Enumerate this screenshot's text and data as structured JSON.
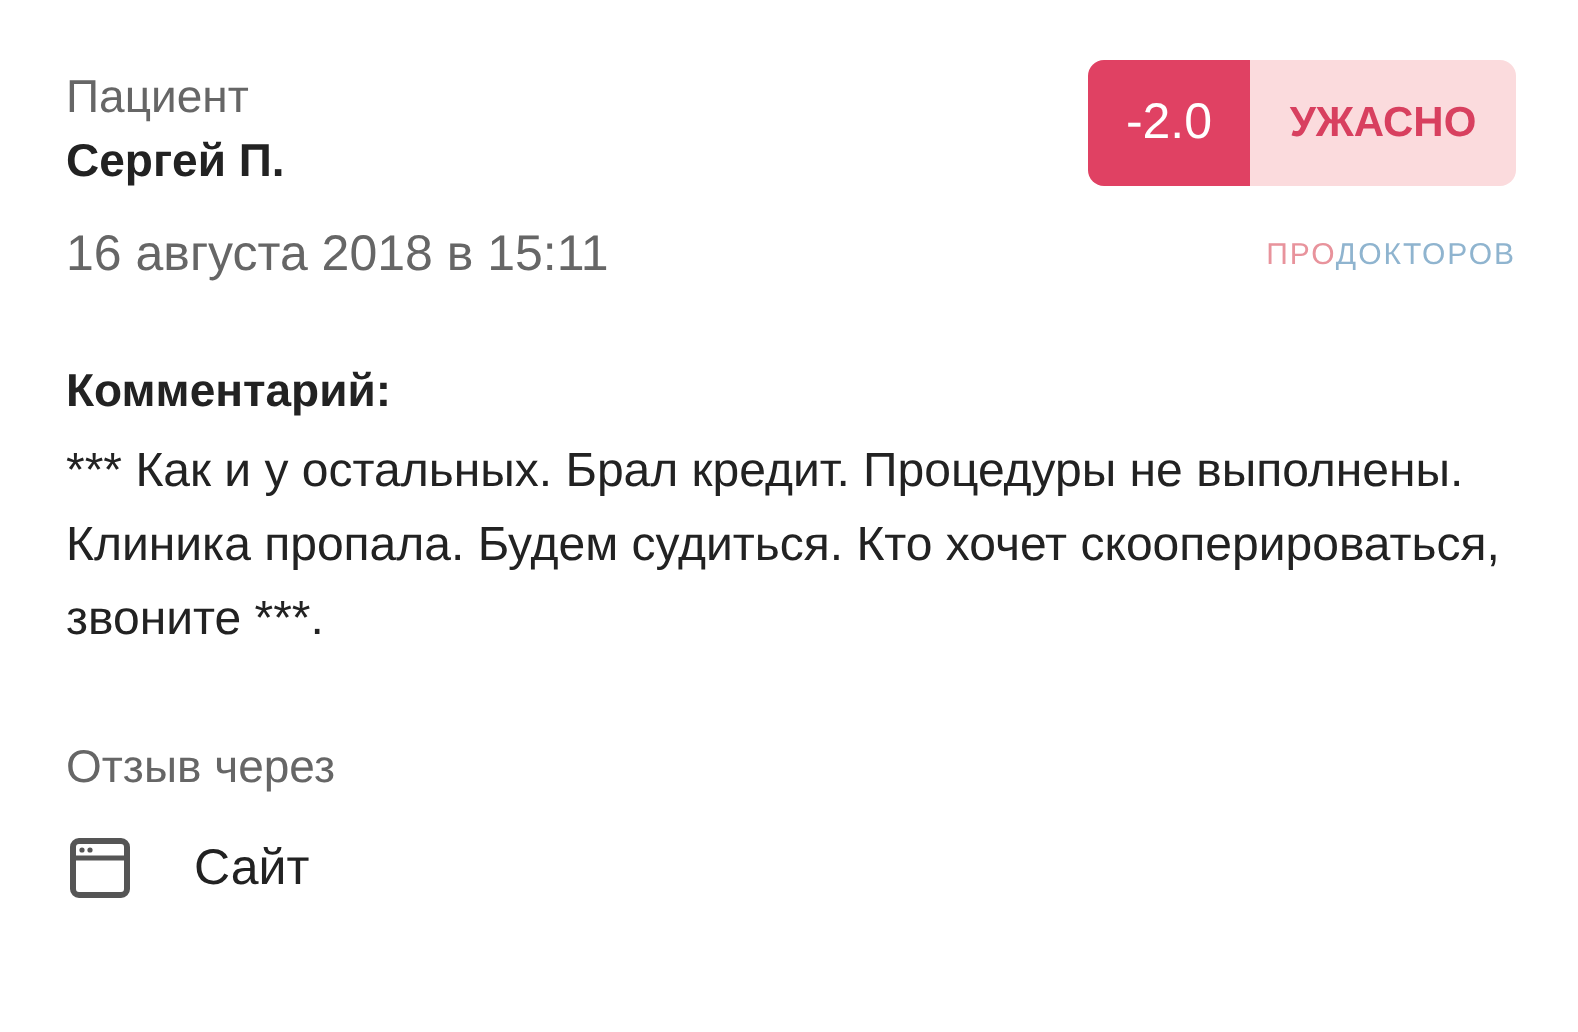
{
  "author": {
    "label": "Пациент",
    "name": "Сергей П."
  },
  "rating": {
    "score": "-2.0",
    "verdict": "УЖАСНО"
  },
  "date": "16 августа 2018 в 15:11",
  "logo": {
    "part_1": "ПРО",
    "part_2": "ДОКТОРОВ"
  },
  "comment": {
    "heading": "Комментарий:",
    "text": "*** Как и у остальных. Брал кредит. Процедуры не выполнены. Клиника пропала. Будем судиться. Кто хочет скооперироваться, звоните ***."
  },
  "source": {
    "label": "Отзыв через",
    "channel": "Сайт"
  }
}
